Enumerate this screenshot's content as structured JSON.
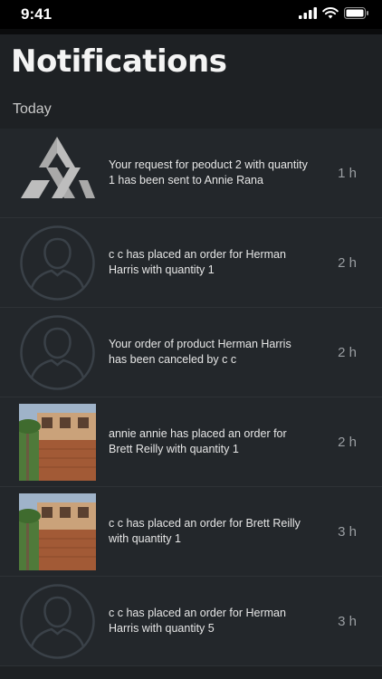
{
  "status_bar": {
    "time": "9:41",
    "icons": [
      "signal-icon",
      "wifi-icon",
      "battery-icon"
    ]
  },
  "header": {
    "title": "Notifications"
  },
  "section": {
    "label": "Today"
  },
  "notifications": [
    {
      "avatar": "logo",
      "message": "Your request for peoduct 2 with quantity 1 has been sent to Annie Rana",
      "time": "1 h"
    },
    {
      "avatar": "person",
      "message": "c c has placed an order for Herman Harris with quantity 1",
      "time": "2 h"
    },
    {
      "avatar": "person",
      "message": "Your order of product Herman Harris has been canceled by c c",
      "time": "2 h"
    },
    {
      "avatar": "photo",
      "message": "annie annie has placed an order for Brett Reilly with quantity 1",
      "time": "2 h"
    },
    {
      "avatar": "photo",
      "message": "c c has placed an order for Brett Reilly with quantity 1",
      "time": "3 h"
    },
    {
      "avatar": "person",
      "message": "c c has placed an order for Herman Harris with quantity 5",
      "time": "3 h"
    }
  ],
  "colors": {
    "background": "#1e2124",
    "row": "#23272b",
    "time_text": "#9a9ea2",
    "avatar_ring": "#3a4148"
  }
}
